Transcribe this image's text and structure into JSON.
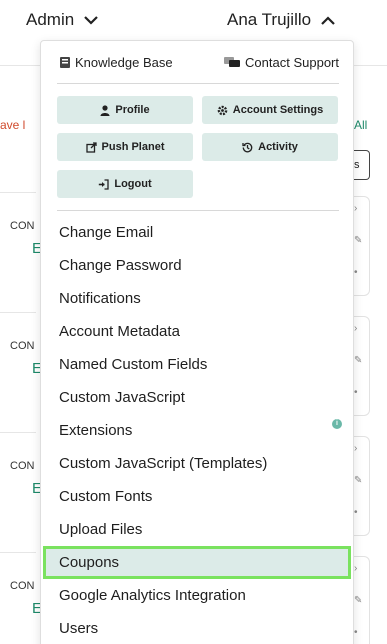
{
  "topbar": {
    "admin_label": "Admin",
    "user_label": "Ana Trujillo"
  },
  "background": {
    "left_link": "ave l",
    "right_link": "All",
    "right_button": "s",
    "cards": [
      {
        "con": "CON",
        "e": "E"
      },
      {
        "con": "CON",
        "e": "E"
      },
      {
        "con": "CON",
        "e": "E"
      },
      {
        "con": "CON",
        "e": "E"
      }
    ]
  },
  "dropdown": {
    "links": {
      "knowledge_base": "Knowledge Base",
      "contact_support": "Contact Support"
    },
    "quick_buttons": {
      "profile": "Profile",
      "account_settings": "Account Settings",
      "push_planet": "Push Planet",
      "activity": "Activity",
      "logout": "Logout"
    },
    "menu_items": [
      "Change Email",
      "Change Password",
      "Notifications",
      "Account Metadata",
      "Named Custom Fields",
      "Custom JavaScript",
      "Extensions",
      "Custom JavaScript (Templates)",
      "Custom Fonts",
      "Upload Files",
      "Coupons",
      "Google Analytics Integration",
      "Users"
    ],
    "selected_item": "Coupons",
    "info_badge": "i"
  },
  "colors": {
    "button_bg": "#dcebe8",
    "highlight_border": "#7ae25f",
    "accent_green": "#1e8a6a",
    "accent_red": "#d04a2c"
  }
}
